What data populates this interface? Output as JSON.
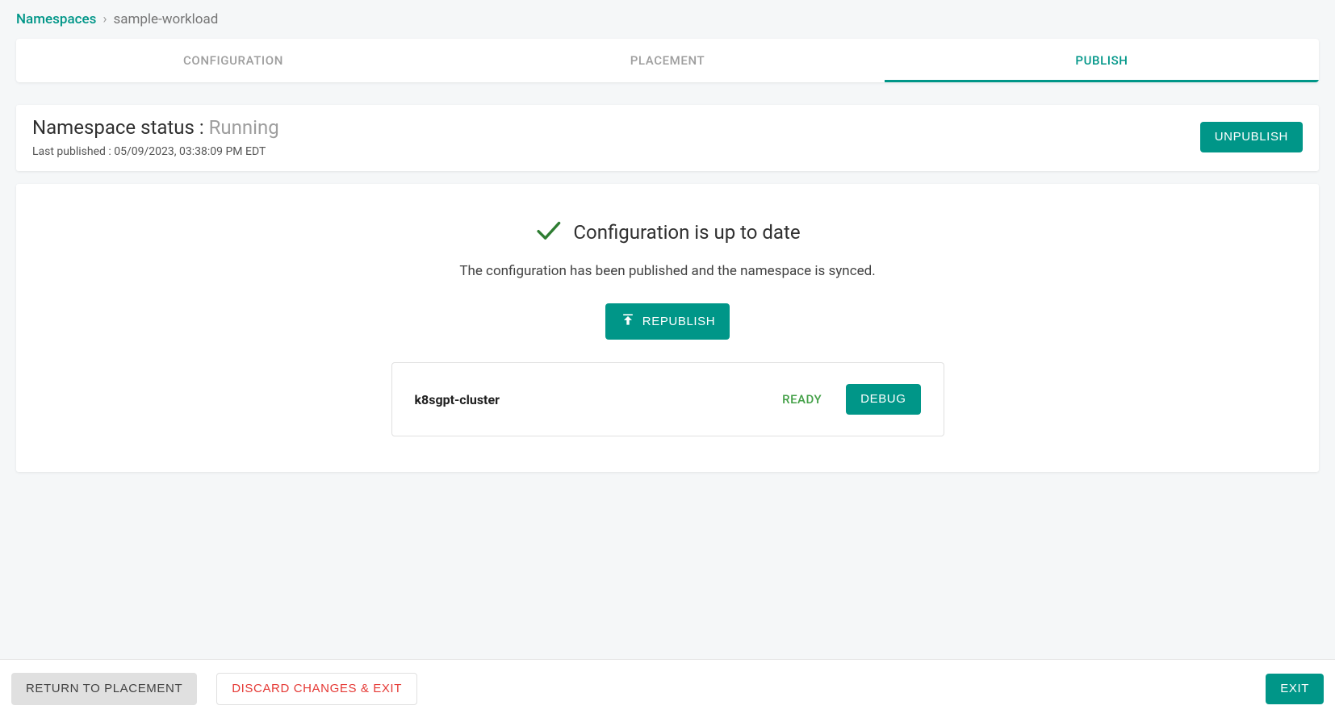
{
  "breadcrumb": {
    "root": "Namespaces",
    "separator": "›",
    "current": "sample-workload"
  },
  "tabs": [
    {
      "label": "CONFIGURATION"
    },
    {
      "label": "PLACEMENT"
    },
    {
      "label": "PUBLISH"
    }
  ],
  "active_tab": 2,
  "status": {
    "label": "Namespace status : ",
    "value": "Running",
    "pub_label": "Last published : ",
    "pub_value": "05/09/2023, 03:38:09 PM EDT",
    "unpublish_label": "UNPUBLISH"
  },
  "config": {
    "title": "Configuration is up to date",
    "description": "The configuration has been published and the namespace is synced.",
    "republish_label": "REPUBLISH"
  },
  "cluster": {
    "name": "k8sgpt-cluster",
    "status": "READY",
    "debug_label": "DEBUG"
  },
  "footer": {
    "return_label": "RETURN TO PLACEMENT",
    "discard_label": "DISCARD CHANGES & EXIT",
    "exit_label": "EXIT"
  }
}
